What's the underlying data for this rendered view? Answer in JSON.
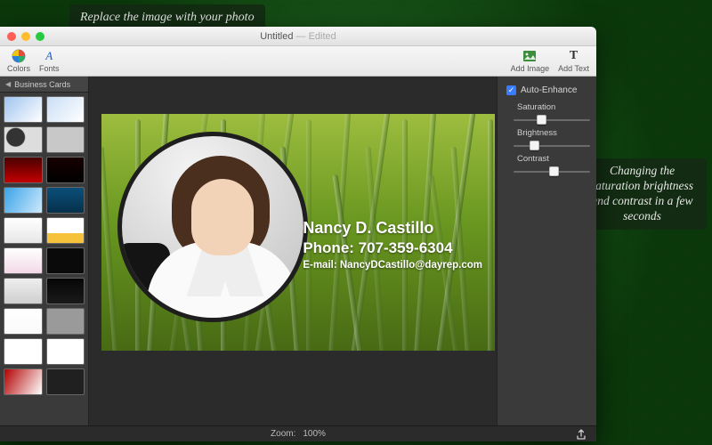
{
  "callouts": {
    "top": "Replace the image with your photo",
    "right": "Changing the saturation brightness and contrast in a few seconds"
  },
  "window": {
    "title_main": "Untitled",
    "title_suffix": " — Edited"
  },
  "toolbar": {
    "colors": "Colors",
    "fonts": "Fonts",
    "add_image": "Add Image",
    "add_text": "Add Text"
  },
  "sidebar": {
    "heading": "Business Cards",
    "templates": [
      {
        "bg": "linear-gradient(135deg,#9fc4ef,#fff)"
      },
      {
        "bg": "linear-gradient(135deg,#c9def5,#fff)"
      },
      {
        "bg": "radial-gradient(circle at 30% 40%,#333 0 10px,#ddd 11px)"
      },
      {
        "bg": "#c8c8c8"
      },
      {
        "bg": "linear-gradient(#4a0000,#c30000)"
      },
      {
        "bg": "linear-gradient(#170000,#000)"
      },
      {
        "bg": "linear-gradient(120deg,#3aa3e8,#cde9fb)"
      },
      {
        "bg": "linear-gradient(#0a4f7a,#06304b)"
      },
      {
        "bg": "linear-gradient(#fff,#e6e6e6)"
      },
      {
        "bg": "linear-gradient(180deg,#fff 60%,#f7c23b 60%)"
      },
      {
        "bg": "linear-gradient(#fff,#f2d9e6)"
      },
      {
        "bg": "#0a0a0a"
      },
      {
        "bg": "linear-gradient(#eee,#cfcfcf)"
      },
      {
        "bg": "linear-gradient(#060606,#1a1a1a)"
      },
      {
        "bg": "linear-gradient(#fff,#fafafa)"
      },
      {
        "bg": "#9a9a9a"
      },
      {
        "bg": "linear-gradient(#fff,#fff)"
      },
      {
        "bg": "linear-gradient(#fff,#fff)"
      },
      {
        "bg": "linear-gradient(120deg,#b30000,#fff)"
      },
      {
        "bg": "#202020"
      }
    ]
  },
  "card": {
    "name": "Nancy D. Castillo",
    "phone": "Phone: 707-359-6304",
    "email": "E-mail: NancyDCastillo@dayrep.com"
  },
  "props": {
    "auto_enhance": "Auto-Enhance",
    "sliders": [
      {
        "label": "Saturation",
        "pos": 26
      },
      {
        "label": "Brightness",
        "pos": 18
      },
      {
        "label": "Contrast",
        "pos": 40
      }
    ]
  },
  "status": {
    "zoom_label": "Zoom:",
    "zoom_value": "100%"
  },
  "colors": {
    "accent": "#e07a1f"
  }
}
